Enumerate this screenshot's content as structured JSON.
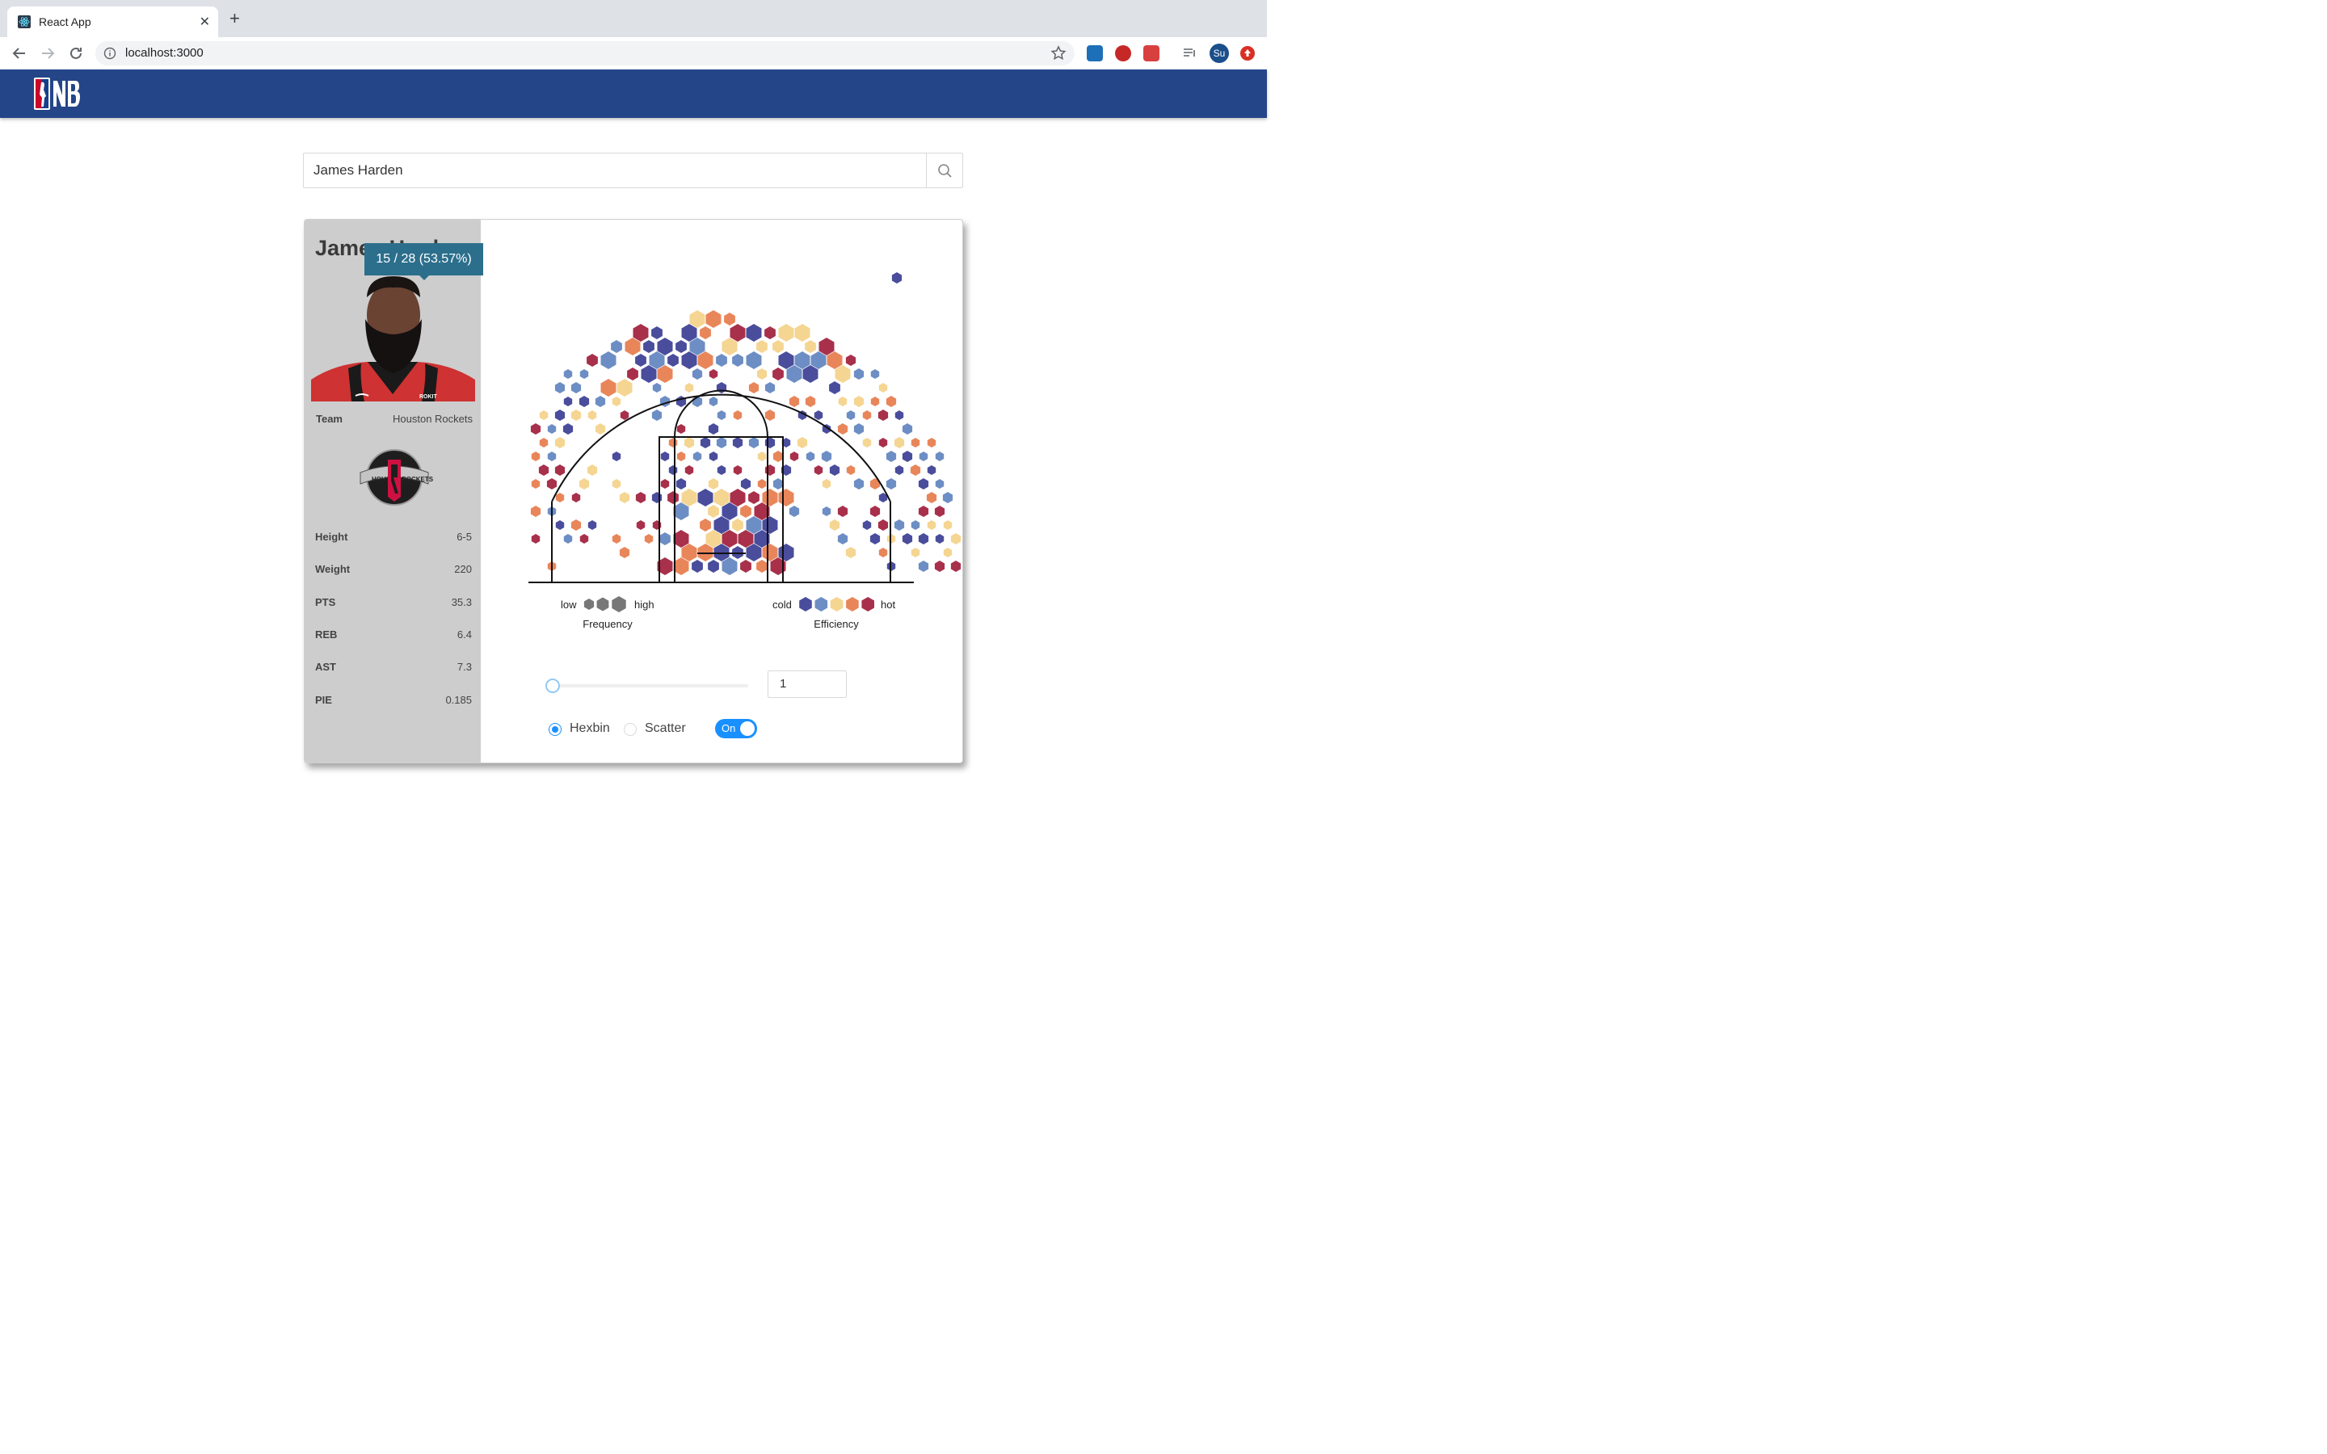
{
  "browser": {
    "tab_title": "React App",
    "tab_close": "✕",
    "new_tab": "+",
    "url": "localhost:3000",
    "avatar_initials": "Su"
  },
  "search": {
    "value": "James Harden"
  },
  "player": {
    "name": "James Harden",
    "team_label": "Team",
    "team": "Houston Rockets",
    "stats": [
      {
        "label": "Height",
        "value": "6-5"
      },
      {
        "label": "Weight",
        "value": "220"
      },
      {
        "label": "PTS",
        "value": "35.3"
      },
      {
        "label": "REB",
        "value": "6.4"
      },
      {
        "label": "AST",
        "value": "7.3"
      },
      {
        "label": "PIE",
        "value": "0.185"
      }
    ]
  },
  "chart": {
    "tooltip": "15 / 28 (53.57%)",
    "legend_frequency": {
      "low": "low",
      "high": "high",
      "title": "Frequency"
    },
    "legend_efficiency": {
      "cold": "cold",
      "hot": "hot",
      "title": "Efficiency"
    },
    "efficiency_colors": [
      "#4a4d9c",
      "#6d8ec4",
      "#f5d592",
      "#e8865a",
      "#a8304b"
    ],
    "frequency_color": "#777777"
  },
  "controls": {
    "slider_value": 0,
    "number_input": "1",
    "radio_hexbin": "Hexbin",
    "radio_scatter": "Scatter",
    "selected": "Hexbin",
    "toggle_label": "On",
    "toggle_state": true
  }
}
